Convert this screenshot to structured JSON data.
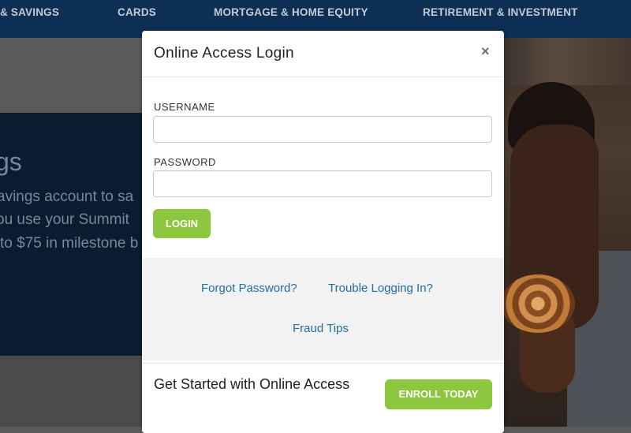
{
  "nav": {
    "items": [
      {
        "label": "& SAVINGS"
      },
      {
        "label": "CARDS"
      },
      {
        "label": "MORTGAGE & HOME EQUITY"
      },
      {
        "label": "RETIREMENT & INVESTMENT"
      }
    ]
  },
  "hero": {
    "heading": "gs",
    "lines": [
      "avings account to sa",
      "ou use your Summit",
      "to $75 in milestone b"
    ]
  },
  "modal": {
    "title": "Online Access Login",
    "close": "×",
    "username_label": "USERNAME",
    "username_value": "",
    "password_label": "PASSWORD",
    "password_value": "",
    "login_button": "LOGIN",
    "links": {
      "forgot_password": "Forgot Password?",
      "trouble_logging_in": "Trouble Logging In?",
      "fraud_tips": "Fraud Tips"
    },
    "enroll_text": "Get Started with Online Access",
    "enroll_button": "ENROLL TODAY"
  },
  "colors": {
    "nav_bg": "#0c2f53",
    "accent_green": "#8dc63f",
    "link_blue": "#1f6eaa"
  }
}
